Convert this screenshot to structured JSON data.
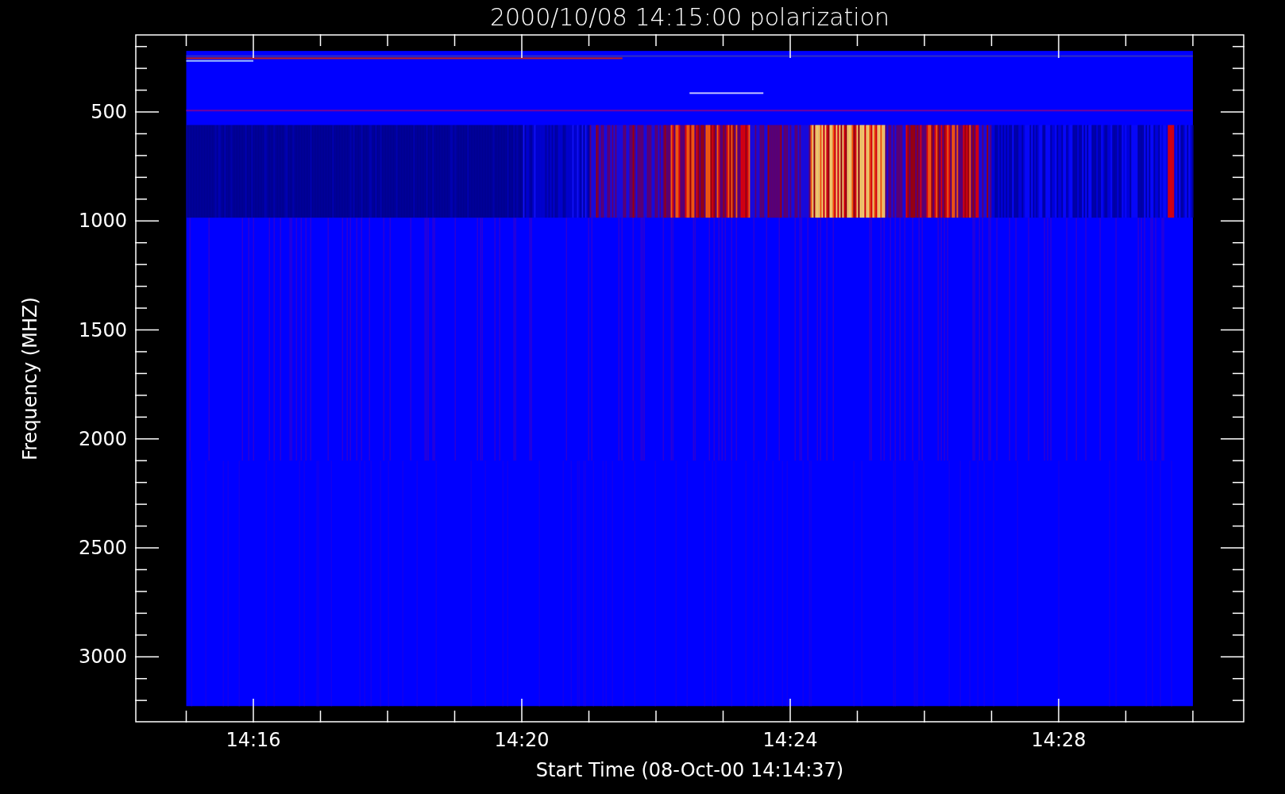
{
  "title": "2000/10/08 14:15:00 polarization",
  "plot": {
    "ylabel": "Frequency (MHZ)",
    "xlabel": "Start Time (08-Oct-00 14:14:37)",
    "y_ticks": [
      {
        "label": "500"
      },
      {
        "label": "1000"
      },
      {
        "label": "1500"
      },
      {
        "label": "2000"
      },
      {
        "label": "2500"
      },
      {
        "label": "3000"
      }
    ],
    "x_ticks": [
      {
        "label": "14:16"
      },
      {
        "label": "14:20"
      },
      {
        "label": "14:24"
      },
      {
        "label": "14:28"
      }
    ]
  }
}
